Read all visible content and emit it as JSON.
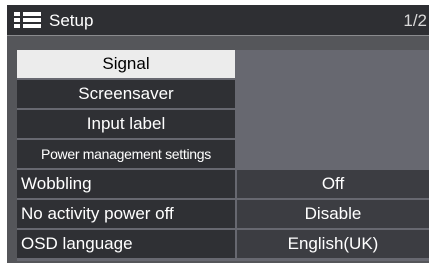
{
  "header": {
    "icon": "menu-list-icon",
    "title": "Setup",
    "page": "1/2"
  },
  "submenus": [
    {
      "label": "Signal",
      "selected": true
    },
    {
      "label": "Screensaver",
      "selected": false
    },
    {
      "label": "Input label",
      "selected": false
    },
    {
      "label": "Power management settings",
      "selected": false
    }
  ],
  "settings": [
    {
      "label": "Wobbling",
      "value": "Off"
    },
    {
      "label": "No activity power off",
      "value": "Disable"
    },
    {
      "label": "OSD language",
      "value": "English(UK)"
    }
  ]
}
